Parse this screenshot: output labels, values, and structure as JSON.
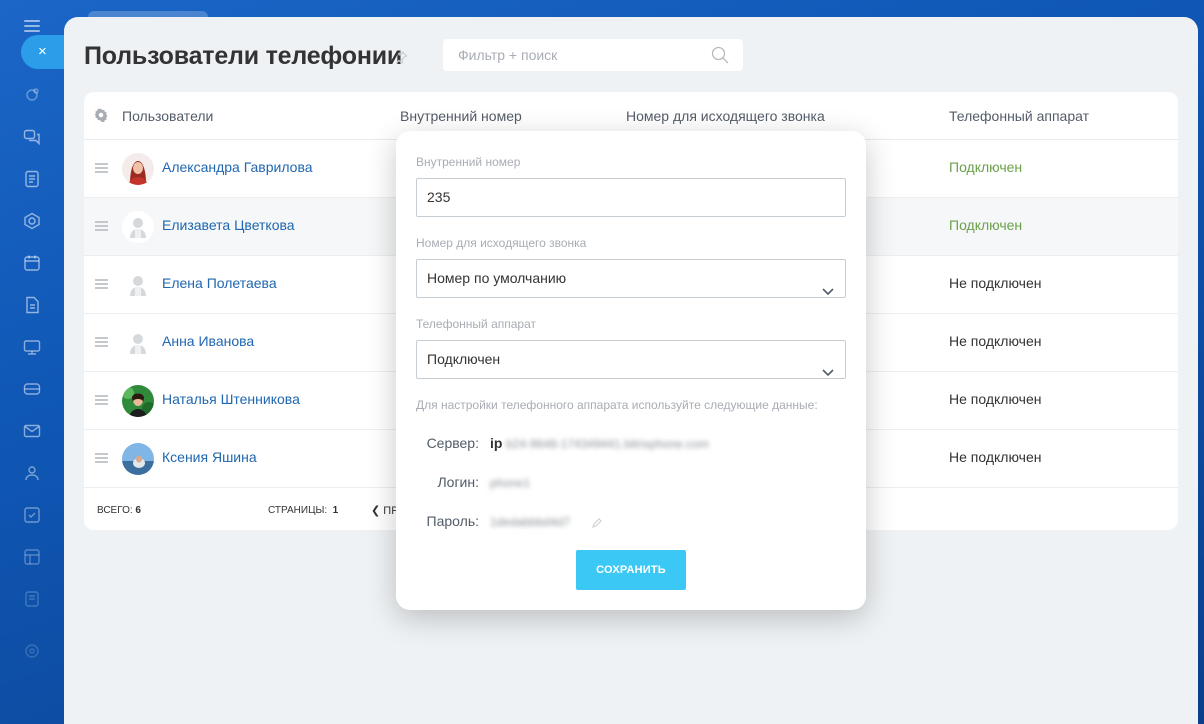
{
  "page": {
    "title": "Пользователи телефонии",
    "search_placeholder": "Фильтр + поиск"
  },
  "colors": {
    "accent": "#3bc8f5",
    "link": "#2067b0",
    "connected": "#6ba04b",
    "rail_active": "#2c9de8"
  },
  "rail": {
    "close_label": "×",
    "icons": [
      "bot-icon",
      "chat-icon",
      "feed-icon",
      "hexagon-icon",
      "calendar-icon",
      "document-icon",
      "board-icon",
      "inbox-icon",
      "mail-icon",
      "users-icon",
      "task-icon",
      "grid-icon",
      "store-icon",
      "settings-icon"
    ]
  },
  "table": {
    "columns": {
      "users": "Пользователи",
      "extension": "Внутренний номер",
      "outgoing": "Номер для исходящего звонка",
      "device": "Телефонный аппарат"
    },
    "rows": [
      {
        "name": "Александра Гаврилова",
        "device": "Подключен",
        "connected": true,
        "avatar": "photo-red"
      },
      {
        "name": "Елизавета Цветкова",
        "device": "Подключен",
        "connected": true,
        "avatar": "placeholder"
      },
      {
        "name": "Елена Полетаева",
        "device": "Не подключен",
        "connected": false,
        "avatar": "placeholder"
      },
      {
        "name": "Анна Иванова",
        "device": "Не подключен",
        "connected": false,
        "avatar": "placeholder"
      },
      {
        "name": "Наталья Штенникова",
        "device": "Не подключен",
        "connected": false,
        "avatar": "photo-green"
      },
      {
        "name": "Ксения Яшина",
        "device": "Не подключен",
        "connected": false,
        "avatar": "photo-sky"
      }
    ],
    "footer": {
      "total_label": "ВСЕГО:",
      "total_value": "6",
      "pages_label": "СТРАНИЦЫ:",
      "pages_value": "1",
      "prev_label": "ПР"
    }
  },
  "popup": {
    "extension_label": "Внутренний номер",
    "extension_value": "235",
    "outgoing_label": "Номер для исходящего звонка",
    "outgoing_value": "Номер по умолчанию",
    "device_label": "Телефонный аппарат",
    "device_value": "Подключен",
    "hint": "Для настройки телефонного аппарата используйте следующие данные:",
    "server_label": "Сервер:",
    "server_prefix": "ip",
    "server_value": "b24-9648-174349441.bitrixphone.com",
    "login_label": "Логин:",
    "login_value": "phone1",
    "password_label": "Пароль:",
    "password_value": "1dedabbbd4d7",
    "save_label": "Сохранить"
  }
}
